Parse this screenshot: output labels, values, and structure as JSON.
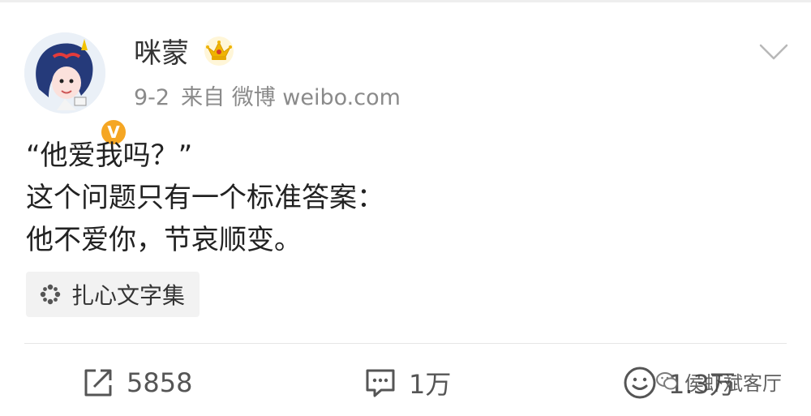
{
  "post": {
    "author": "咪蒙",
    "date": "9-2",
    "source": "来自 微博 weibo.com",
    "lines": [
      "“他爱我吗？”",
      "这个问题只有一个标准答案：",
      "他不爱你，节哀顺变。"
    ],
    "topic": "扎心文字集"
  },
  "actions": {
    "repost_count": "5858",
    "comment_count": "1万",
    "like_count": "1.3万"
  },
  "watermark": "侯虾斌客厅",
  "colors": {
    "badge": "#f5a623",
    "crown": "#f0b400",
    "crown_jewel": "#d63a2b"
  },
  "icons": {
    "verified": "verified-badge",
    "crown": "crown-icon",
    "chevron": "chevron-down-icon",
    "topic": "super-topic-icon",
    "repost": "repost-icon",
    "comment": "comment-icon",
    "like": "like-icon"
  }
}
